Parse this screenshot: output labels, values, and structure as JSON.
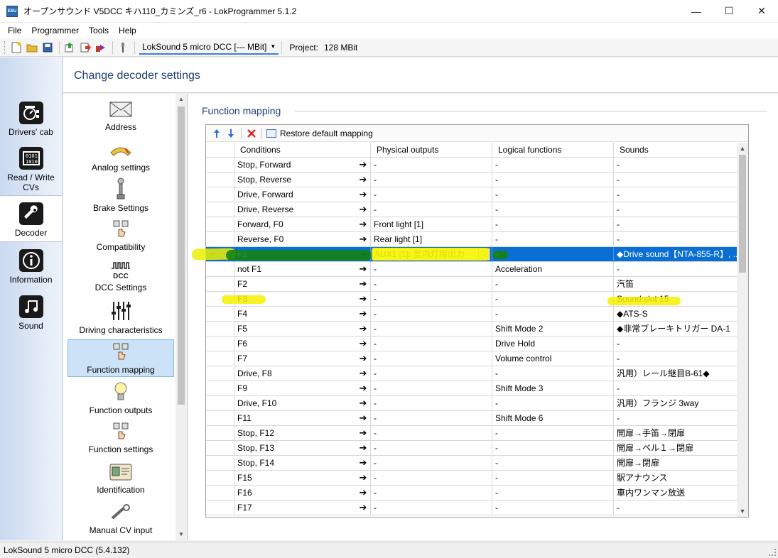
{
  "window": {
    "title": "オープンサウンド V5DCC キハ110_カミンズ_r6 - LokProgrammer 5.1.2",
    "app_icon_label": "ESU",
    "minimize": "—",
    "maximize": "☐",
    "close": "✕"
  },
  "menu": [
    "File",
    "Programmer",
    "Tools",
    "Help"
  ],
  "toolbar": {
    "decoder": "LokSound 5 micro DCC [--- MBit]",
    "project_label": "Project:",
    "project_value": "128 MBit"
  },
  "leftnav": [
    {
      "label": "Drivers' cab",
      "icon": "cab-icon"
    },
    {
      "label": "Read / Write CVs",
      "icon": "cv-icon"
    },
    {
      "label": "Decoder",
      "icon": "wrench-icon"
    },
    {
      "label": "Information",
      "icon": "info-icon"
    },
    {
      "label": "Sound",
      "icon": "note-icon"
    }
  ],
  "header": {
    "title": "Change decoder settings"
  },
  "categories": [
    {
      "label": "Address",
      "icon": "envelope-icon"
    },
    {
      "label": "Analog settings",
      "icon": "gauge-icon"
    },
    {
      "label": "Brake Settings",
      "icon": "brake-icon"
    },
    {
      "label": "Compatibility",
      "icon": "hand-icon"
    },
    {
      "label": "DCC Settings",
      "icon": "dcc-icon",
      "icon_text": "DCC"
    },
    {
      "label": "Driving characteristics",
      "icon": "sliders-icon"
    },
    {
      "label": "Function mapping",
      "icon": "hand-icon"
    },
    {
      "label": "Function outputs",
      "icon": "bulb-icon"
    },
    {
      "label": "Function settings",
      "icon": "hand-icon"
    },
    {
      "label": "Identification",
      "icon": "id-card-icon"
    },
    {
      "label": "Manual CV input",
      "icon": "tool-icon"
    }
  ],
  "section": {
    "title": "Function mapping"
  },
  "grid_toolbar": {
    "restore_label": "Restore default mapping"
  },
  "columns": [
    "Conditions",
    "Physical outputs",
    "Logical functions",
    "Sounds"
  ],
  "rows": [
    [
      "Stop, Forward",
      "-",
      "-",
      "-"
    ],
    [
      "Stop, Reverse",
      "-",
      "-",
      "-"
    ],
    [
      "Drive, Forward",
      "-",
      "-",
      "-"
    ],
    [
      "Drive, Reverse",
      "-",
      "-",
      "-"
    ],
    [
      "Forward, F0",
      "Front light [1]",
      "-",
      "-"
    ],
    [
      "Reverse, F0",
      "Rear light [1]",
      "-",
      "-"
    ],
    [
      "F1",
      "AUX1 [1]: 室内灯用出力",
      "-",
      "◆Drive sound【NTA-855-R】, ..."
    ],
    [
      "not F1",
      "-",
      "Acceleration",
      "-"
    ],
    [
      "F2",
      "-",
      "-",
      "汽笛"
    ],
    [
      "F3",
      "-",
      "-",
      "Sound slot 15"
    ],
    [
      "F4",
      "-",
      "-",
      "◆ATS-S"
    ],
    [
      "F5",
      "-",
      "Shift Mode 2",
      "◆非常ブレーキトリガー DA-1"
    ],
    [
      "F6",
      "-",
      "Drive Hold",
      "-"
    ],
    [
      "F7",
      "-",
      "Volume control",
      "-"
    ],
    [
      "Drive, F8",
      "-",
      "-",
      "汎用）レール継目B-61◆"
    ],
    [
      "F9",
      "-",
      "Shift Mode 3",
      "-"
    ],
    [
      "Drive, F10",
      "-",
      "-",
      "汎用）フランジ 3way"
    ],
    [
      "F11",
      "-",
      "Shift Mode 6",
      "-"
    ],
    [
      "Stop, F12",
      "-",
      "-",
      "開扉→手笛→閉扉"
    ],
    [
      "Stop, F13",
      "-",
      "-",
      "開扉→ベル１→閉扉"
    ],
    [
      "Stop, F14",
      "-",
      "-",
      "開扉→閉扉"
    ],
    [
      "F15",
      "-",
      "-",
      "駅アナウンス"
    ],
    [
      "F16",
      "-",
      "-",
      "車内ワンマン放送"
    ],
    [
      "F17",
      "-",
      "-",
      "-"
    ]
  ],
  "selected_row": 6,
  "status": {
    "text": "LokSound 5 micro DCC (5.4.132)"
  },
  "colors": {
    "selection": "#0a6fd4",
    "highlight_yellow": "#f5f500",
    "highlight_green": "#1a8a1a",
    "heading": "#1f3f73"
  }
}
